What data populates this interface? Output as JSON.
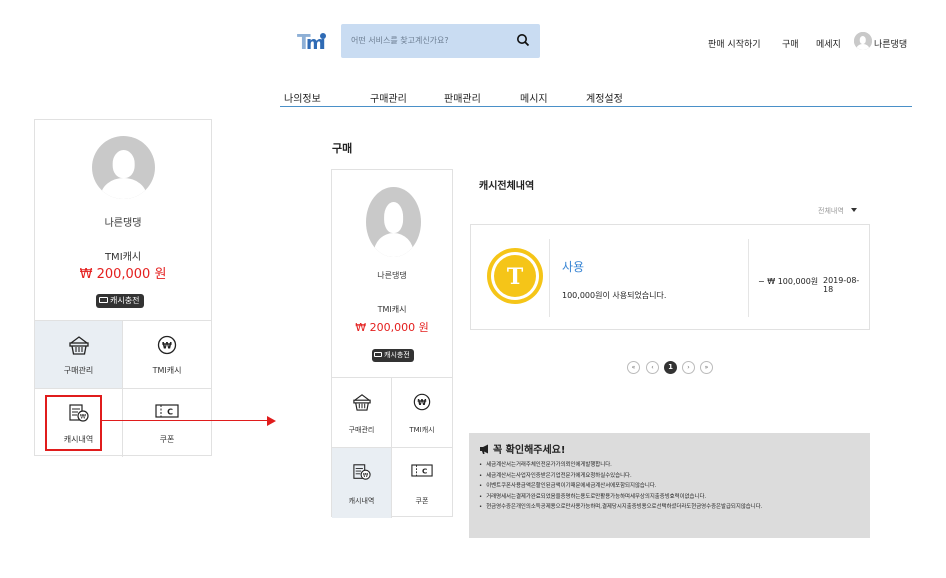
{
  "header": {
    "logo": "TMI",
    "search_placeholder": "어떤 서비스를 찾고계신가요?",
    "links": [
      "판매 시작하기",
      "구매",
      "메세지"
    ],
    "username": "나른댕댕"
  },
  "main_nav": [
    "나의정보",
    "구매관리",
    "판매관리",
    "메시지",
    "계정설정"
  ],
  "page_title": "구매",
  "profile_zoomed": {
    "name": "나른댕댕",
    "cash_label": "TMI캐시",
    "cash_amount": "₩ 200,000 원",
    "charge_label": "캐시충전",
    "menu": [
      {
        "label": "구매관리",
        "icon": "basket-icon"
      },
      {
        "label": "TMI캐시",
        "icon": "won-coin-icon"
      },
      {
        "label": "캐시내역",
        "icon": "cash-history-icon"
      },
      {
        "label": "쿠폰",
        "icon": "coupon-icon"
      }
    ]
  },
  "profile": {
    "name": "나른댕댕",
    "cash_label": "TMI캐시",
    "cash_amount": "₩ 200,000 원",
    "charge_label": "캐시충전",
    "menu": [
      {
        "label": "구매관리",
        "icon": "basket-icon"
      },
      {
        "label": "TMI캐시",
        "icon": "won-coin-icon"
      },
      {
        "label": "캐시내역",
        "icon": "cash-history-icon"
      },
      {
        "label": "쿠폰",
        "icon": "coupon-icon"
      }
    ]
  },
  "cash_history": {
    "title": "캐시전체내역",
    "filter": "전체내역",
    "items": [
      {
        "icon_letter": "T",
        "type": "사용",
        "description": "100,000원이 사용되었습니다.",
        "amount": "− ₩ 100,000원",
        "date": "2019-08-18"
      }
    ]
  },
  "pagination": {
    "first": "«",
    "prev": "‹",
    "current": "1",
    "next": "›",
    "last": "»"
  },
  "notice": {
    "title": "꼭 확인해주세요!",
    "items": [
      "세금계산서는거래주체인전문가가의뢰인에게발행합니다.",
      "세금계산서는사업자인증받은기업전문가에게요청하실수있습니다.",
      "이벤트쿠폰사용금액은할인된금액이기때문에세금계산서에포함되지않습니다.",
      "거래명세서는결제가완료되었음을증명하는용도로만활용가능하며세무상의지출증빙효력이없습니다.",
      "현금영수증은개인의소득공제용으로만사용가능하며,결제당시지출증빙용으로선택하셨더라도현금영수증은발급되지않습니다."
    ]
  },
  "colors": {
    "accent": "#3a86d4",
    "cash": "#e4201f",
    "highlight": "#e01c1c",
    "search_bg": "#c9dcf2",
    "coin": "#f5c518"
  }
}
